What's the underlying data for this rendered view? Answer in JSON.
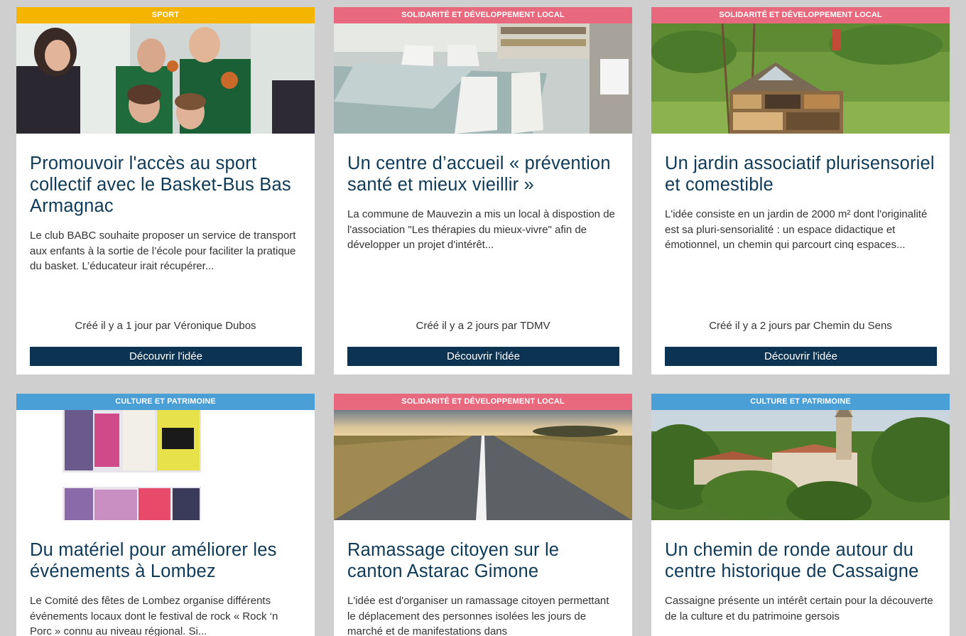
{
  "cards": [
    {
      "category": "Sport",
      "title": "Promouvoir l'accès au sport collectif avec le Basket-Bus Bas Armagnac",
      "description": "Le club BABC souhaite proposer un service de transport aux enfants à la sortie de l’école pour faciliter la pratique du basket. L’éducateur irait récupérer...",
      "meta": "Créé il y a 1 jour par Véronique Dubos",
      "cta": "Découvrir l'idée",
      "tag_color": "#f5b400"
    },
    {
      "category": "Solidarité et développement local",
      "title": "Un centre d’accueil « prévention santé et mieux vieillir »",
      "description": "La commune de Mauvezin a mis un local à dispostion de l'association \"Les thérapies du mieux-vivre\" afin de développer un projet d'intérêt...",
      "meta": "Créé il y a 2 jours par TDMV",
      "cta": "Découvrir l'idée",
      "tag_color": "#e8697d"
    },
    {
      "category": "Solidarité et développement local",
      "title": "Un jardin associatif plurisensoriel et comestible",
      "description": "L'idée consiste en un jardin de 2000 m² dont l'originalité est sa pluri-sensorialité : un espace didactique et émotionnel, un chemin qui parcourt cinq espaces...",
      "meta": "Créé il y a 2 jours par Chemin du Sens",
      "cta": "Découvrir l'idée",
      "tag_color": "#e8697d"
    },
    {
      "category": "Culture et patrimoine",
      "title": "Du matériel pour améliorer les événements à Lombez",
      "description": "Le Comité des fêtes de Lombez organise différents événements locaux dont le festival de rock « Rock ‘n Porc » connu au niveau régional. Si...",
      "tag_color": "#4a9fd6"
    },
    {
      "category": "Solidarité et développement local",
      "title": "Ramassage citoyen sur le canton Astarac Gimone",
      "description": "L'idée est d'organiser un ramassage citoyen permettant le déplacement des personnes isolées les jours de marché et de manifestations dans",
      "tag_color": "#e8697d"
    },
    {
      "category": "Culture et patrimoine",
      "title": "Un chemin de ronde autour du centre historique de Cassaigne",
      "description": "Cassaigne présente un intérêt certain pour la découverte de la culture et du patrimoine gersois",
      "tag_color": "#4a9fd6"
    }
  ]
}
